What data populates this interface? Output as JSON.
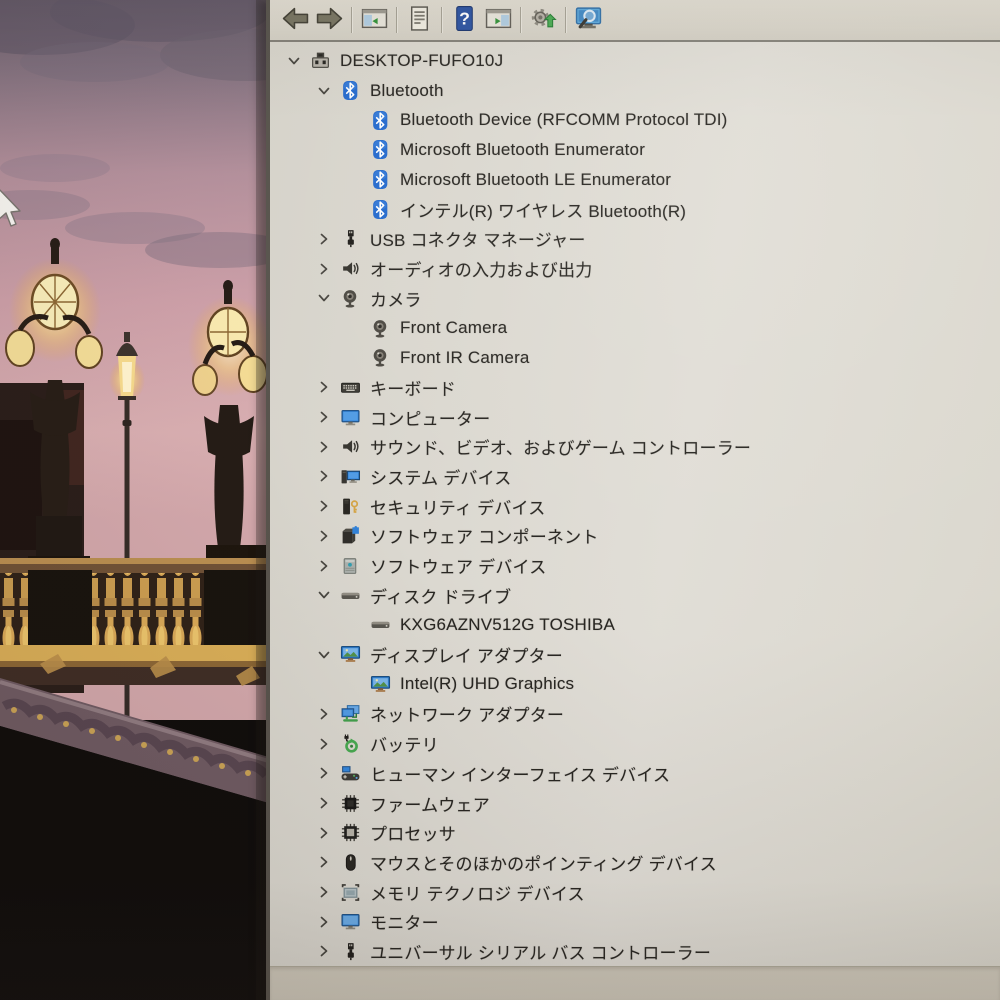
{
  "window": {
    "app": "device-manager",
    "computer_name": "DESKTOP-FUFO10J"
  },
  "toolbar": {
    "buttons": [
      {
        "id": "back",
        "icon": "arrow-left-icon",
        "divider_after": false
      },
      {
        "id": "forward",
        "icon": "arrow-right-icon",
        "divider_after": true
      },
      {
        "id": "show-console-tree",
        "icon": "console-tree-icon",
        "divider_after": true
      },
      {
        "id": "properties",
        "icon": "properties-icon",
        "divider_after": true
      },
      {
        "id": "help",
        "icon": "help-icon",
        "divider_after": false
      },
      {
        "id": "show-action-pane",
        "icon": "action-pane-icon",
        "divider_after": true
      },
      {
        "id": "update-driver",
        "icon": "update-driver-icon",
        "divider_after": true
      },
      {
        "id": "scan-hardware-changes",
        "icon": "scan-hardware-icon",
        "divider_after": false
      }
    ]
  },
  "tree": {
    "rows": [
      {
        "label": "DESKTOP-FUFO10J",
        "level": 0,
        "state": "expanded",
        "icon": "computer"
      },
      {
        "label": "Bluetooth",
        "level": 1,
        "state": "expanded",
        "icon": "bluetooth"
      },
      {
        "label": "Bluetooth Device (RFCOMM Protocol TDI)",
        "level": 2,
        "state": "leaf",
        "icon": "bluetooth"
      },
      {
        "label": "Microsoft Bluetooth Enumerator",
        "level": 2,
        "state": "leaf",
        "icon": "bluetooth"
      },
      {
        "label": "Microsoft Bluetooth LE Enumerator",
        "level": 2,
        "state": "leaf",
        "icon": "bluetooth"
      },
      {
        "label": "インテル(R) ワイヤレス Bluetooth(R)",
        "level": 2,
        "state": "leaf",
        "icon": "bluetooth"
      },
      {
        "label": "USB コネクタ マネージャー",
        "level": 1,
        "state": "collapsed",
        "icon": "usb"
      },
      {
        "label": "オーディオの入力および出力",
        "level": 1,
        "state": "collapsed",
        "icon": "speaker"
      },
      {
        "label": "カメラ",
        "level": 1,
        "state": "expanded",
        "icon": "camera"
      },
      {
        "label": "Front Camera",
        "level": 2,
        "state": "leaf",
        "icon": "camera"
      },
      {
        "label": "Front IR Camera",
        "level": 2,
        "state": "leaf",
        "icon": "camera"
      },
      {
        "label": "キーボード",
        "level": 1,
        "state": "collapsed",
        "icon": "keyboard"
      },
      {
        "label": "コンピューター",
        "level": 1,
        "state": "collapsed",
        "icon": "monitor"
      },
      {
        "label": "サウンド、ビデオ、およびゲーム コントローラー",
        "level": 1,
        "state": "collapsed",
        "icon": "speaker"
      },
      {
        "label": "システム デバイス",
        "level": 1,
        "state": "collapsed",
        "icon": "system"
      },
      {
        "label": "セキュリティ デバイス",
        "level": 1,
        "state": "collapsed",
        "icon": "security"
      },
      {
        "label": "ソフトウェア コンポーネント",
        "level": 1,
        "state": "collapsed",
        "icon": "software-component"
      },
      {
        "label": "ソフトウェア デバイス",
        "level": 1,
        "state": "collapsed",
        "icon": "software-device"
      },
      {
        "label": "ディスク ドライブ",
        "level": 1,
        "state": "expanded",
        "icon": "disk"
      },
      {
        "label": "KXG6AZNV512G TOSHIBA",
        "level": 2,
        "state": "leaf",
        "icon": "disk"
      },
      {
        "label": "ディスプレイ アダプター",
        "level": 1,
        "state": "expanded",
        "icon": "display"
      },
      {
        "label": "Intel(R) UHD Graphics",
        "level": 2,
        "state": "leaf",
        "icon": "display"
      },
      {
        "label": "ネットワーク アダプター",
        "level": 1,
        "state": "collapsed",
        "icon": "network"
      },
      {
        "label": "バッテリ",
        "level": 1,
        "state": "collapsed",
        "icon": "battery"
      },
      {
        "label": "ヒューマン インターフェイス デバイス",
        "level": 1,
        "state": "collapsed",
        "icon": "hid"
      },
      {
        "label": "ファームウェア",
        "level": 1,
        "state": "collapsed",
        "icon": "firmware"
      },
      {
        "label": "プロセッサ",
        "level": 1,
        "state": "collapsed",
        "icon": "processor"
      },
      {
        "label": "マウスとそのほかのポインティング デバイス",
        "level": 1,
        "state": "collapsed",
        "icon": "mouse"
      },
      {
        "label": "メモリ テクノロジ デバイス",
        "level": 1,
        "state": "collapsed",
        "icon": "memory"
      },
      {
        "label": "モニター",
        "level": 1,
        "state": "collapsed",
        "icon": "monitor2"
      },
      {
        "label": "ユニバーサル シリアル バス コントローラー",
        "level": 1,
        "state": "collapsed",
        "icon": "usb"
      }
    ]
  },
  "colors": {
    "window_bg": "#dbd8d0",
    "toolbar_bg": "#d6d2c7",
    "text": "#24221e",
    "bluetooth_blue": "#2268cc",
    "accent_blue": "#2f84dc",
    "help_blue": "#274f9f",
    "status_band": "#cfc9bb",
    "sky_pink": "#cb9da6",
    "lamp_glow": "#f6d98a"
  }
}
